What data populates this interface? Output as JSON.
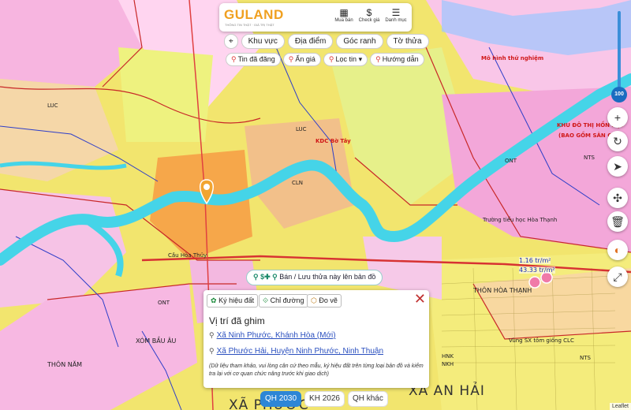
{
  "app": {
    "logo": "GULAND",
    "logo_sub": "THÔNG TIN THẬT · GIÁ TRỊ THẬT",
    "header_buttons": [
      {
        "label": "Mua bán",
        "icon": "building-icon"
      },
      {
        "label": "Check giá",
        "icon": "dollar-icon"
      },
      {
        "label": "Danh mục",
        "icon": "menu-icon"
      }
    ]
  },
  "toolbar": {
    "row1": [
      "Khu vực",
      "Địa điểm",
      "Góc ranh",
      "Tờ thửa"
    ],
    "row2": [
      "Tin đã đăng",
      "Ẩn giá",
      "Lọc tin",
      "Hướng dẫn"
    ]
  },
  "zoom": {
    "value": "100"
  },
  "map_labels": {
    "khu_do_thi": "KHU ĐÔ THỊ HỒN HỢP",
    "bao_gom": "(BAO GỒM SÂN GOLF",
    "truong_tieu_hoc": "Trường tiểu học Hòa Thạnh",
    "thon_hoa_thanh": "THÔN HÒA THẠNH",
    "xa_an_hai": "XÃ AN HẢI",
    "xa_phuoc": "XÃ PHƯỚC",
    "xom_bau_au": "XÓM BẦU ÂU",
    "thon_nam": "THÔN NĂM",
    "cau_hoa": "Cầu Hòa Thủy",
    "mo_hinh": "Mô hình thử nghiệm",
    "price1": "1.16 tr/m²",
    "price2": "43.33 tr/m²",
    "vung_sx": "Vùng SX tôm giống CLC",
    "kdc": "KDC Bờ Tây",
    "luc": "LUC",
    "ont": "ONT",
    "cln": "CLN",
    "nts": "NTS",
    "hnk": "HNK",
    "nkh": "NKH"
  },
  "pin_bar": {
    "text": "Bán / Lưu thửa này lên bản đồ"
  },
  "popup": {
    "tabs": [
      "Ký hiệu đất",
      "Chỉ đường",
      "Đo vẽ"
    ],
    "title": "Vị trí đã ghim",
    "address_new": "Xã Ninh Phước, Khánh Hòa (Mới)",
    "address_old": "Xã Phước Hải, Huyện Ninh Phước, Ninh Thuận",
    "note": "(Dữ liệu tham khảo, vui lòng cân cứ theo mẫu, ký hiệu đất trên từng loại bản đồ và kiểm tra lại với cơ quan chức năng trước khi giao dịch)"
  },
  "plan_tabs": [
    "QH 2030",
    "KH 2026",
    "QH khác"
  ],
  "attribution": "Leaflet"
}
